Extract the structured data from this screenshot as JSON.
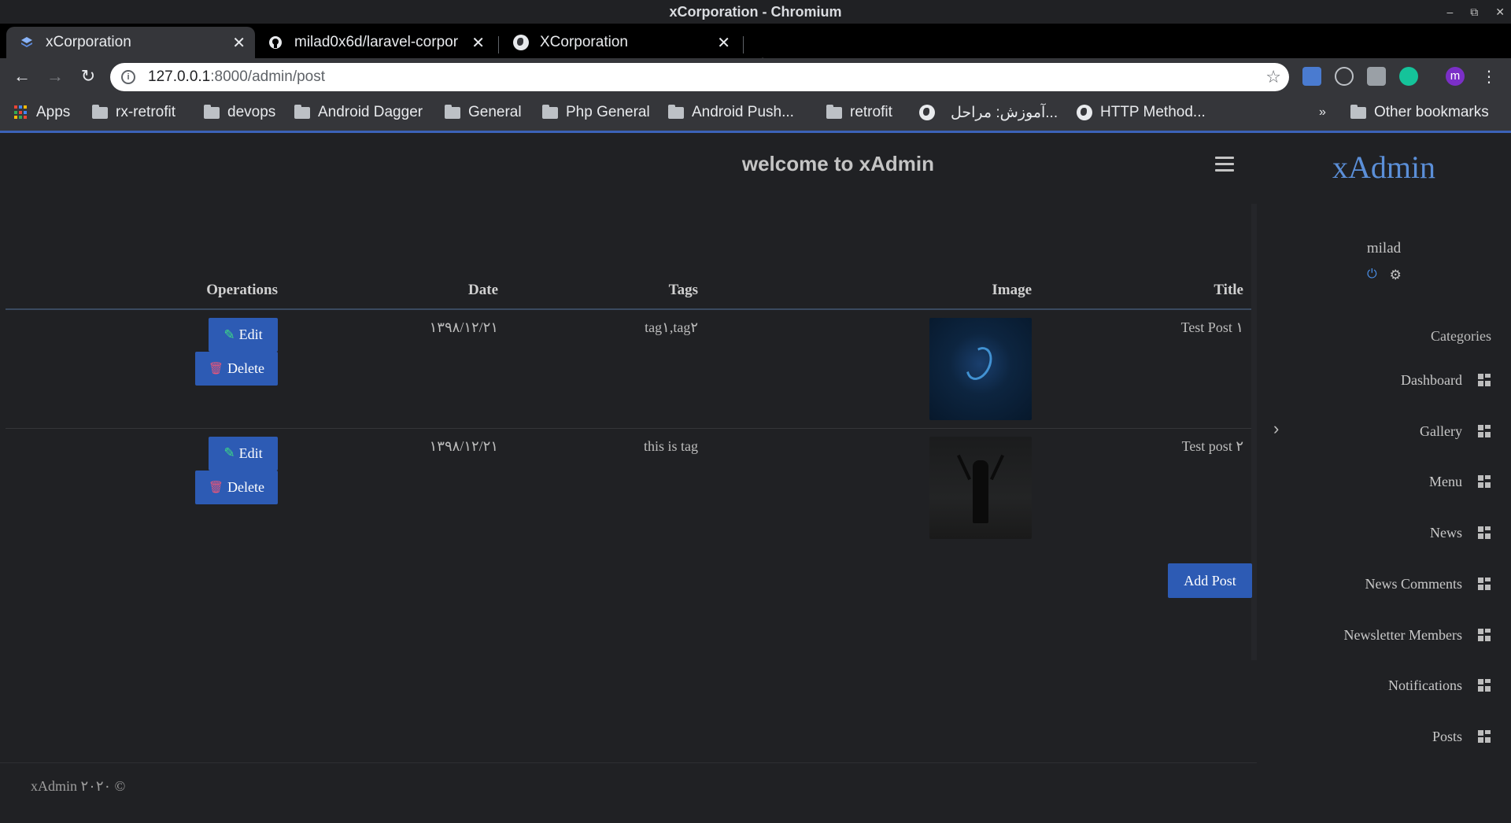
{
  "window": {
    "title": "xCorporation - Chromium"
  },
  "tabs": [
    {
      "title": "xCorporation",
      "active": true
    },
    {
      "title": "milad0x6d/laravel-corpor",
      "active": false
    },
    {
      "title": "XCorporation",
      "active": false
    }
  ],
  "address_bar": {
    "host": "127.0.0.1",
    "path": ":8000/admin/post"
  },
  "bookmarks": [
    "Apps",
    "rx-retrofit",
    "devops",
    "Android Dagger",
    "General",
    "Php General",
    "Android Push...",
    "retrofit",
    "آموزش: مراحل...",
    "HTTP Method...",
    "»",
    "Other bookmarks"
  ],
  "header": {
    "welcome": "welcome to xAdmin"
  },
  "table": {
    "headers": {
      "operations": "Operations",
      "date": "Date",
      "tags": "Tags",
      "image": "Image",
      "title": "Title"
    },
    "rows": [
      {
        "title": "Test Post ۱",
        "tags": "tag۱,tag۲",
        "date": "۱۳۹۸/۱۲/۲۱",
        "edit": "Edit",
        "delete": "Delete",
        "image": "debian-swirl-thumbnail"
      },
      {
        "title": "Test post ۲",
        "tags": "this is tag",
        "date": "۱۳۹۸/۱۲/۲۱",
        "edit": "Edit",
        "delete": "Delete",
        "image": "silhouette-thumbnail"
      }
    ]
  },
  "add_post": "Add Post",
  "footer": "xAdmin ۲۰۲۰ ©",
  "sidebar": {
    "brand": "xAdmin",
    "user": "milad",
    "categories_label": "Categories",
    "items": [
      "Dashboard",
      "Gallery",
      "Menu",
      "News",
      "News Comments",
      "Newsletter Members",
      "Notifications",
      "Posts"
    ]
  },
  "colors": {
    "accent": "#2d5bb4",
    "brand": "#5b8fd8",
    "background": "#202124"
  }
}
